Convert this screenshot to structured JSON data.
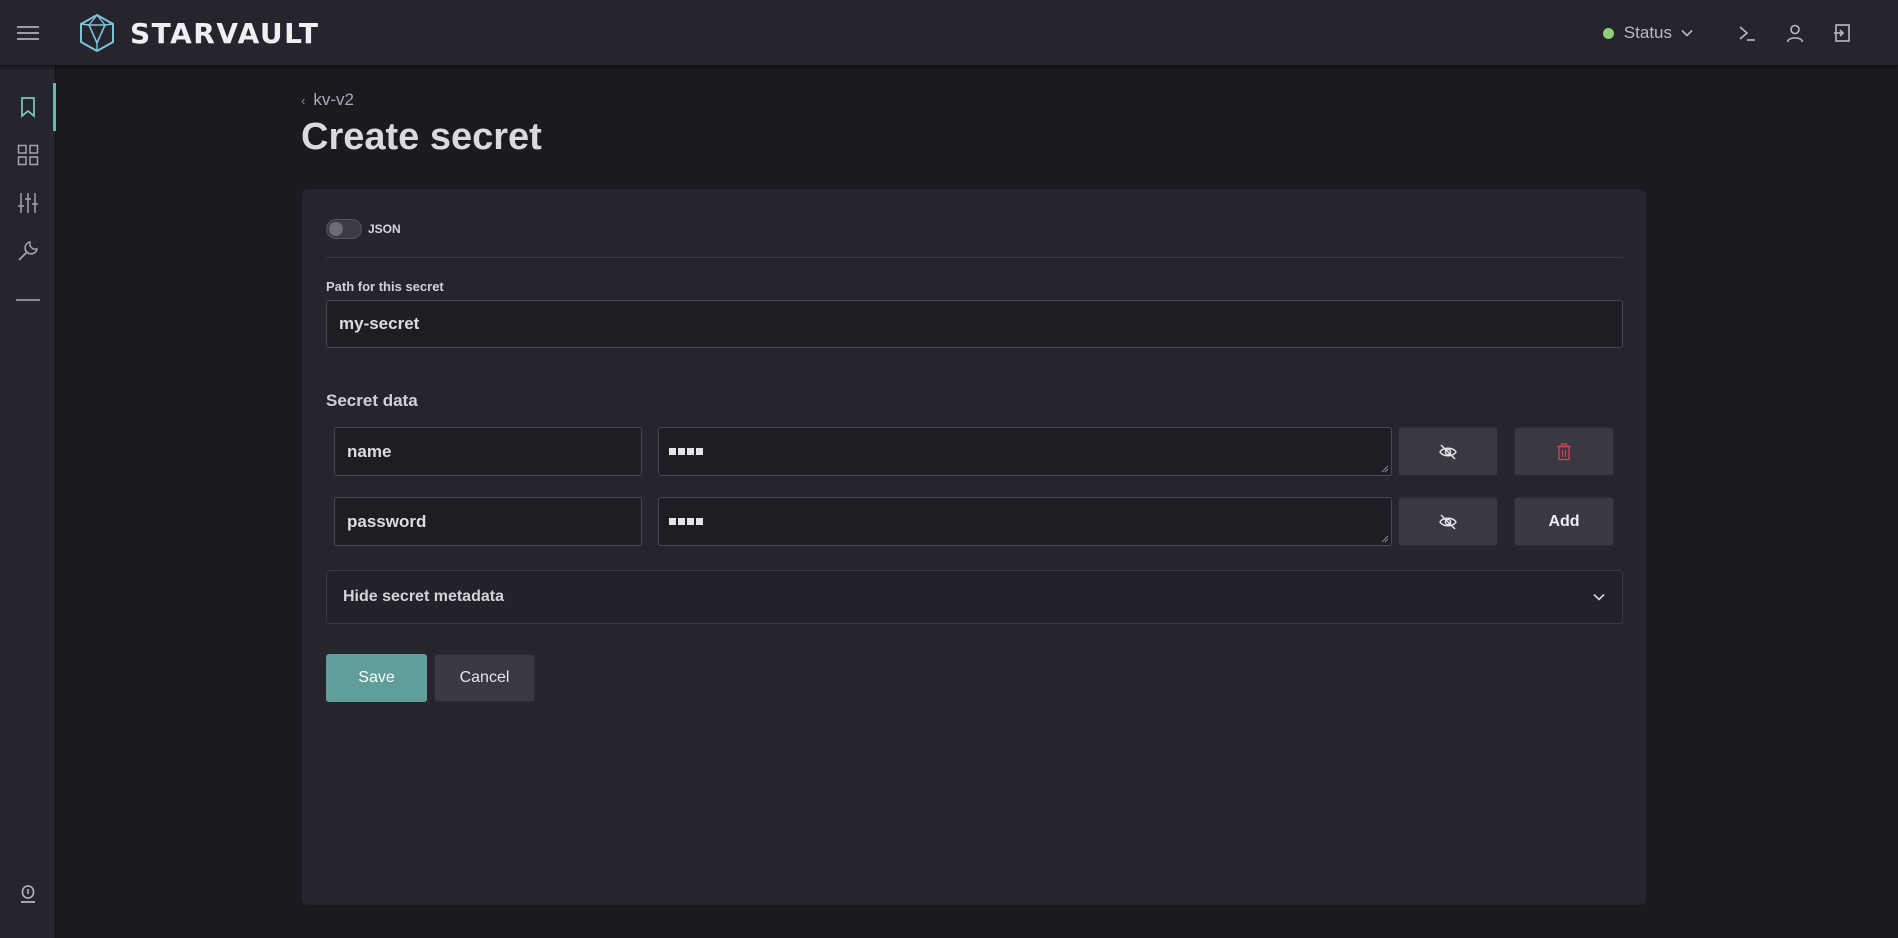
{
  "app": {
    "brand": "STARVAULT"
  },
  "header": {
    "status_label": "Status",
    "status_color": "#8ecf76",
    "icons": [
      "menu-icon",
      "logo-icon",
      "chevron-down-icon",
      "terminal-icon",
      "user-icon",
      "logout-icon"
    ]
  },
  "sidebar": {
    "items": [
      {
        "icon": "bookmark-icon",
        "active": true
      },
      {
        "icon": "dashboard-icon",
        "active": false
      },
      {
        "icon": "sliders-icon",
        "active": false
      },
      {
        "icon": "tools-icon",
        "active": false
      }
    ],
    "bottom_icon": "info-icon",
    "accent_color": "#69b7b0"
  },
  "breadcrumb": {
    "label": "kv-v2"
  },
  "page": {
    "title": "Create secret"
  },
  "form": {
    "json_toggle_label": "JSON",
    "json_toggle_on": false,
    "path_label": "Path for this secret",
    "path_value": "my-secret",
    "secret_data_title": "Secret data",
    "rows": [
      {
        "key": "name",
        "masked": true,
        "action": "delete"
      },
      {
        "key": "password",
        "masked": true,
        "action": "add"
      }
    ],
    "add_label": "Add",
    "metadata_label": "Hide secret metadata",
    "save_label": "Save",
    "cancel_label": "Cancel",
    "save_color": "#5f9e99",
    "delete_color": "#c9444c"
  }
}
